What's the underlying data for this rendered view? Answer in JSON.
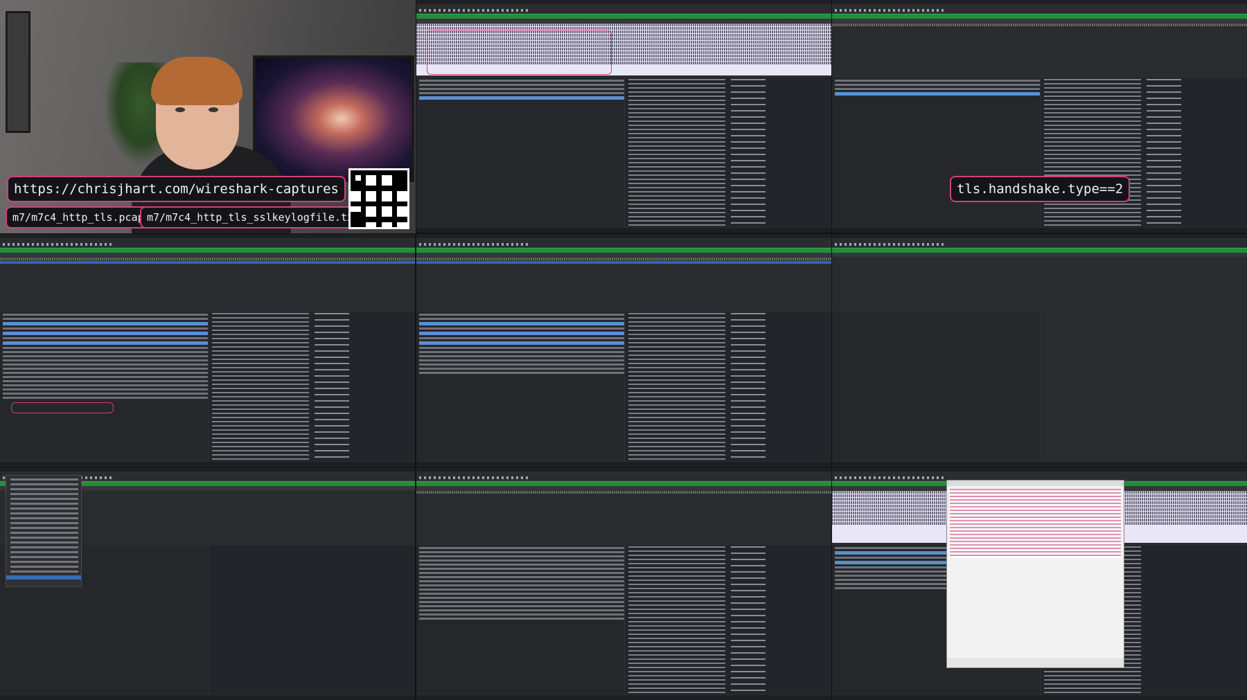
{
  "overlay": {
    "url": "https://chrisjhart.com/wireshark-captures",
    "pcap_file": "m7/m7c4_http_tls.pcap",
    "keylog_file": "m7/m7c4_http_tls_sslkeylogfile.txt",
    "display_filter": "tls.handshake.type==2"
  },
  "colors": {
    "accent_border": "#d23f7e",
    "filter_bar": "#1f8f3a",
    "selection": "#2f6fb9"
  },
  "panes": [
    {
      "name": "webcam"
    },
    {
      "name": "wireshark-tls-stream"
    },
    {
      "name": "wireshark-filtered-server-hello"
    },
    {
      "name": "wireshark-client-hello"
    },
    {
      "name": "wireshark-server-hello"
    },
    {
      "name": "wireshark-empty-list"
    },
    {
      "name": "wireshark-edit-menu"
    },
    {
      "name": "wireshark-certificate"
    },
    {
      "name": "wireshark-preferences-dialog"
    }
  ]
}
